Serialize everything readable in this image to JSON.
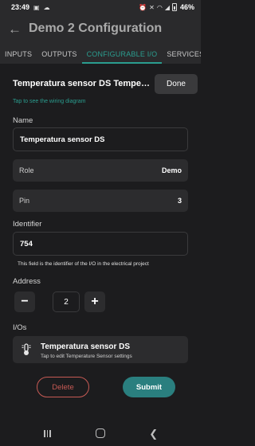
{
  "status_bar": {
    "time": "23:49",
    "battery": "46%",
    "left_icons": [
      "camera-icon",
      "cloud-icon"
    ],
    "right_icons": [
      "alarm-icon",
      "mute-icon",
      "wifi-icon",
      "signal-icon",
      "battery-icon"
    ]
  },
  "appbar": {
    "title": "Demo 2 Configuration"
  },
  "tabs": [
    {
      "label": "INPUTS",
      "active": false
    },
    {
      "label": "OUTPUTS",
      "active": false
    },
    {
      "label": "CONFIGURABLE I/O",
      "active": true
    },
    {
      "label": "SERVICES",
      "active": false
    }
  ],
  "modal": {
    "title": "Temperatura sensor DS Temperatura sensor DS",
    "done_label": "Done",
    "wiring_link": "Tap to see the wiring diagram",
    "name_label": "Name",
    "name_value": "Temperatura sensor DS",
    "role_label": "Role",
    "role_value": "Demo",
    "pin_label": "Pin",
    "pin_value": "3",
    "identifier_label": "Identifier",
    "identifier_value": "754",
    "identifier_helper": "This field is the identifier of the I/O in the electrical project",
    "address_label": "Address",
    "address_value": "2",
    "minus_label": "−",
    "plus_label": "+",
    "ios_label": "I/Os",
    "io_item": {
      "title": "Temperatura sensor DS",
      "subtitle": "Tap to edit Temperature Sensor settings",
      "icon": "thermometer-icon"
    },
    "delete_label": "Delete",
    "submit_label": "Submit"
  },
  "colors": {
    "accent": "#2a9d8f",
    "delete": "#c65a54",
    "submit": "#2a7f7f",
    "background": "#1c1c1e"
  }
}
